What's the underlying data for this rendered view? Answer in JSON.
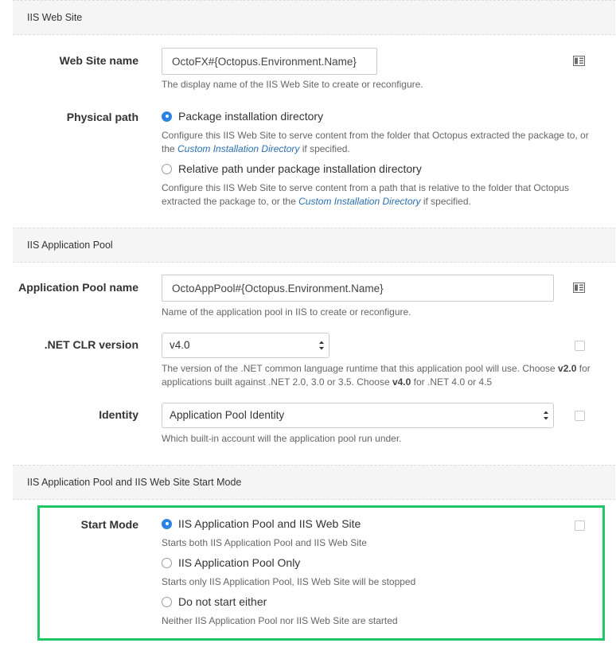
{
  "sections": {
    "web_site": "IIS Web Site",
    "app_pool": "IIS Application Pool",
    "start_mode": "IIS Application Pool and IIS Web Site Start Mode"
  },
  "web_site_name": {
    "label": "Web Site name",
    "value": "OctoFX#{Octopus.Environment.Name}",
    "help": "The display name of the IIS Web Site to create or reconfigure."
  },
  "physical_path": {
    "label": "Physical path",
    "options": [
      {
        "label": "Package installation directory",
        "checked": true,
        "help_before": "Configure this IIS Web Site to serve content from the folder that Octopus extracted the package to, or the ",
        "help_link": "Custom Installation Directory",
        "help_after": " if specified."
      },
      {
        "label": "Relative path under package installation directory",
        "checked": false,
        "help_before": "Configure this IIS Web Site to serve content from a path that is relative to the folder that Octopus extracted the package to, or the ",
        "help_link": "Custom Installation Directory",
        "help_after": " if specified."
      }
    ]
  },
  "app_pool_name": {
    "label": "Application Pool name",
    "value": "OctoAppPool#{Octopus.Environment.Name}",
    "help": "Name of the application pool in IIS to create or reconfigure."
  },
  "clr_version": {
    "label": ".NET CLR version",
    "selected": "v4.0",
    "help_1": "The version of the .NET common language runtime that this application pool will use. Choose ",
    "help_b1": "v2.0",
    "help_2": " for applications built against .NET 2.0, 3.0 or 3.5. Choose ",
    "help_b2": "v4.0",
    "help_3": " for .NET 4.0 or 4.5"
  },
  "identity": {
    "label": "Identity",
    "selected": "Application Pool Identity",
    "help": "Which built-in account will the application pool run under."
  },
  "start_mode": {
    "label": "Start Mode",
    "options": [
      {
        "label": "IIS Application Pool and IIS Web Site",
        "checked": true,
        "help": "Starts both IIS Application Pool and IIS Web Site"
      },
      {
        "label": "IIS Application Pool Only",
        "checked": false,
        "help": "Starts only IIS Application Pool, IIS Web Site will be stopped"
      },
      {
        "label": "Do not start either",
        "checked": false,
        "help": "Neither IIS Application Pool nor IIS Web Site are started"
      }
    ]
  },
  "colors": {
    "accent": "#2b84e3",
    "highlight": "#21c766",
    "link": "#2a6fb0"
  },
  "icons": {
    "bind": "variable-binding-icon"
  }
}
